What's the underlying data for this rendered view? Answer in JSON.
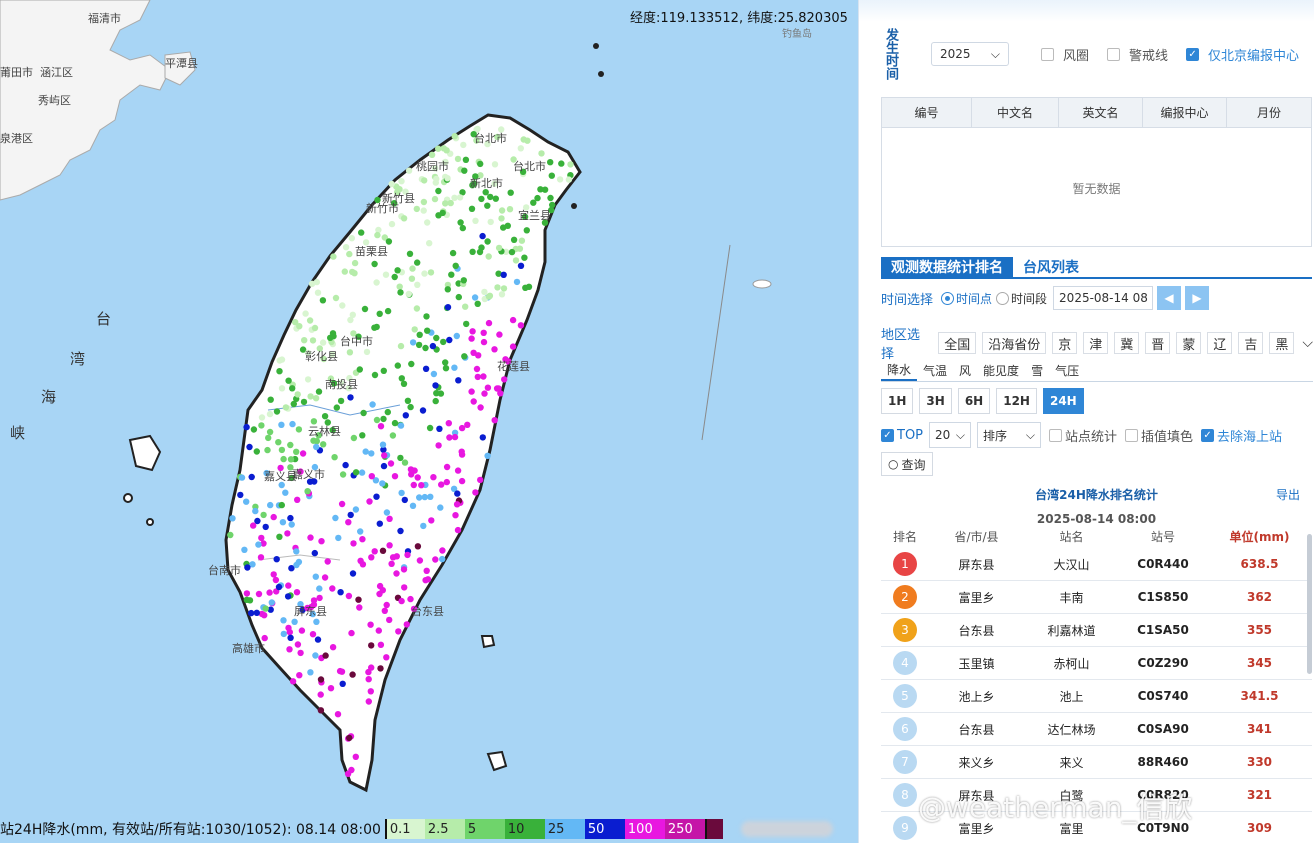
{
  "map": {
    "coord_readout": "经度:119.133512, 纬度:25.820305",
    "attribution": "钓鱼岛",
    "place_labels": [
      "福清市",
      "莆田市",
      "涵江区",
      "平潭县",
      "秀屿区",
      "泉港区",
      "台北市",
      "桃园市",
      "台北市",
      "新北市",
      "新竹县",
      "新竹市",
      "宜兰县",
      "苗栗县",
      "台中市",
      "彰化县",
      "南投县",
      "花莲县",
      "云林县",
      "嘉义县",
      "嘉义市",
      "台南市",
      "屏东县",
      "台东县",
      "高雄市"
    ],
    "sea_label_chars": [
      "台",
      "湾",
      "海",
      "峡"
    ],
    "colors": {
      "sea": "#a8d5f5",
      "land": "#ffffff",
      "mainland": "#f4f4f4"
    }
  },
  "legend": {
    "title": "站24H降水(mm, 有效站/所有站:1030/1052): 08.14 08:00",
    "labels": [
      "0.1",
      "2.5",
      "5",
      "10",
      "25",
      "50",
      "100",
      "250",
      ""
    ],
    "colors": [
      "#d8f5d0",
      "#b6ecaa",
      "#6fd46b",
      "#39b13a",
      "#63b8f5",
      "#0a1dd0",
      "#e817e0",
      "#e815c6",
      "#6a0a3c"
    ]
  },
  "panel": {
    "occur_time_label": "发生时间",
    "year": "2025",
    "options": [
      {
        "label": "风圈",
        "checked": false
      },
      {
        "label": "警戒线",
        "checked": false
      },
      {
        "label": "仅北京编报中心",
        "checked": true
      }
    ],
    "table": {
      "headers": [
        "编号",
        "中文名",
        "英文名",
        "编报中心",
        "月份"
      ],
      "empty_text": "暂无数据"
    },
    "tabs": [
      "观测数据统计排名",
      "台风列表"
    ],
    "time_select_label": "时间选择",
    "radio_point": "时间点",
    "radio_range": "时间段",
    "date_value": "2025-08-14 08",
    "region_label": "地区选择",
    "regions": [
      "全国",
      "沿海省份",
      "京",
      "津",
      "冀",
      "晋",
      "蒙",
      "辽",
      "吉",
      "黑"
    ],
    "variables": [
      "降水",
      "气温",
      "风",
      "能见度",
      "雪",
      "气压"
    ],
    "periods": [
      "1H",
      "3H",
      "6H",
      "12H",
      "24H"
    ],
    "top_label": "TOP",
    "top_value": "20",
    "sort_placeholder": "排序",
    "station_stats": "站点统计",
    "interp_fill": "插值填色",
    "remove_sea": "去除海上站",
    "query": "查询",
    "rank_title": "台湾24H降水排名统计",
    "export": "导出",
    "rank_date": "2025-08-14 08:00",
    "rank_headers": [
      "排名",
      "省/市/县",
      "站名",
      "站号",
      "单位(mm)"
    ],
    "rows": [
      {
        "rank": "1",
        "region": "屏东县",
        "name": "大汉山",
        "id": "C0R440",
        "value": "638.5",
        "color": "#e84545"
      },
      {
        "rank": "2",
        "region": "富里乡",
        "name": "丰南",
        "id": "C1S850",
        "value": "362",
        "color": "#f07c1f"
      },
      {
        "rank": "3",
        "region": "台东县",
        "name": "利嘉林道",
        "id": "C1SA50",
        "value": "355",
        "color": "#f0a21a"
      },
      {
        "rank": "4",
        "region": "玉里镇",
        "name": "赤柯山",
        "id": "C0Z290",
        "value": "345",
        "color": "#b9d9f2"
      },
      {
        "rank": "5",
        "region": "池上乡",
        "name": "池上",
        "id": "C0S740",
        "value": "341.5",
        "color": "#b9d9f2"
      },
      {
        "rank": "6",
        "region": "台东县",
        "name": "达仁林场",
        "id": "C0SA90",
        "value": "341",
        "color": "#b9d9f2"
      },
      {
        "rank": "7",
        "region": "来义乡",
        "name": "来义",
        "id": "88R460",
        "value": "330",
        "color": "#b9d9f2"
      },
      {
        "rank": "8",
        "region": "屏东县",
        "name": "白鹭",
        "id": "C0R820",
        "value": "321",
        "color": "#b9d9f2"
      },
      {
        "rank": "9",
        "region": "富里乡",
        "name": "富里",
        "id": "C0T9N0",
        "value": "309",
        "color": "#b9d9f2"
      }
    ]
  },
  "watermark": "@weatherman_信欣"
}
